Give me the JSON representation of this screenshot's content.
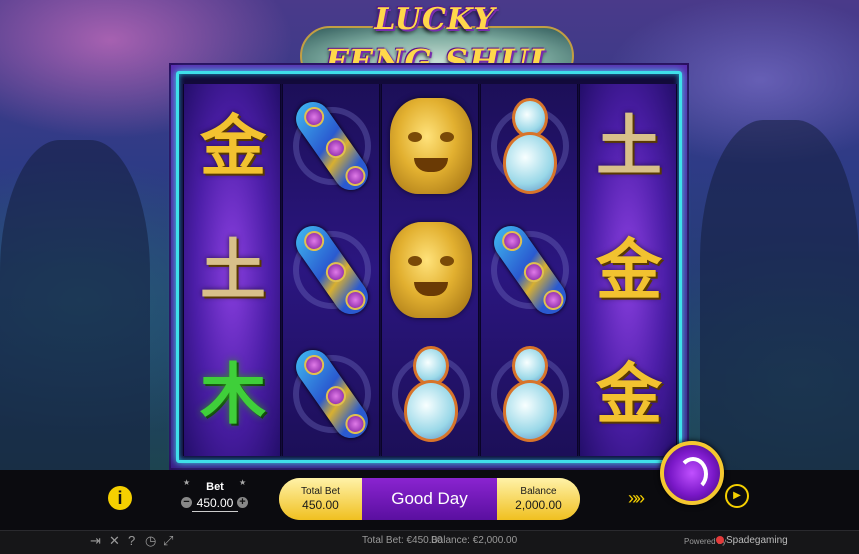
{
  "game": {
    "logo_line1": "LUCKY",
    "logo_line2": "FENG SHUI"
  },
  "reels": [
    [
      {
        "symbol": "gold-kanji",
        "text": "金"
      },
      {
        "symbol": "silver-kanji",
        "text": "土"
      },
      {
        "symbol": "green-kanji",
        "text": "木"
      }
    ],
    [
      {
        "symbol": "ruyi"
      },
      {
        "symbol": "ruyi"
      },
      {
        "symbol": "ruyi"
      }
    ],
    [
      {
        "symbol": "lion-head"
      },
      {
        "symbol": "lion-head"
      },
      {
        "symbol": "gourd"
      }
    ],
    [
      {
        "symbol": "gourd"
      },
      {
        "symbol": "ruyi"
      },
      {
        "symbol": "gourd"
      }
    ],
    [
      {
        "symbol": "silver-kanji",
        "text": "土"
      },
      {
        "symbol": "gold-kanji",
        "text": "金"
      },
      {
        "symbol": "gold-kanji",
        "text": "金"
      }
    ]
  ],
  "controls": {
    "info_label": "i",
    "bet_label": "Bet",
    "bet_value": "450.00",
    "minus": "−",
    "plus": "+",
    "total_bet_label": "Total Bet",
    "total_bet_value": "450.00",
    "message": "Good Day",
    "balance_label": "Balance",
    "balance_value": "2,000.00"
  },
  "status": {
    "total_bet": "Total Bet: €450.00",
    "balance": "Balance: €2,000.00",
    "powered_by": "Powered by",
    "brand": "Spadegaming"
  },
  "icons": [
    "info-icon",
    "bet-star-icon",
    "turbo-icon",
    "spin-icon",
    "autoplay-icon",
    "exit-icon",
    "sound-icon",
    "help-icon",
    "history-icon",
    "fullscreen-icon"
  ],
  "colors": {
    "accent": "#f5d000",
    "frame": "#3fe0ea",
    "spin": "#7a18c8"
  }
}
